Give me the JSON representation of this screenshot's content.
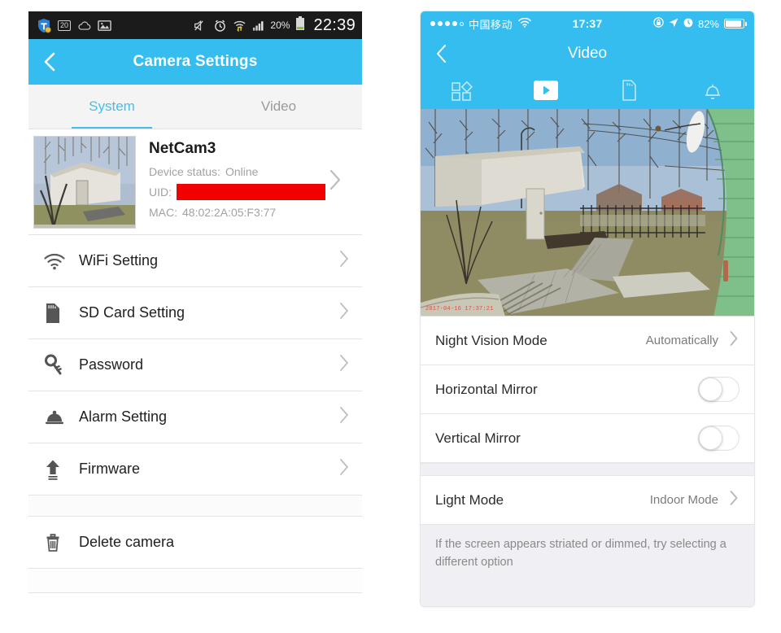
{
  "left_phone": {
    "status_bar": {
      "icons": [
        "shield-icon",
        "notification-count-icon",
        "cloud-icon",
        "image-icon",
        "mute-icon",
        "alarm-clock-icon",
        "wifi-transfer-icon",
        "signal-bars-icon"
      ],
      "notification_count": "20",
      "battery_percent": "20%",
      "clock": "22:39"
    },
    "header": {
      "title": "Camera Settings",
      "back_icon": "chevron-left-icon"
    },
    "tabs": [
      {
        "label": "System",
        "active": true
      },
      {
        "label": "Video",
        "active": false
      }
    ],
    "device_card": {
      "name": "NetCam3",
      "status_label": "Device status:",
      "status_value": "Online",
      "uid_label": "UID:",
      "uid_value": "",
      "mac_label": "MAC:",
      "mac_value": "48:02:2A:05:F3:77",
      "thumbnail_alt": "camera snapshot of white shed and bare trees",
      "chevron": "chevron-right-icon"
    },
    "menu_items": [
      {
        "label": "WiFi Setting",
        "icon": "wifi-icon",
        "chevron": true
      },
      {
        "label": "SD Card Setting",
        "icon": "sd-card-icon",
        "chevron": true
      },
      {
        "label": "Password",
        "icon": "key-icon",
        "chevron": true
      },
      {
        "label": "Alarm Setting",
        "icon": "bell-icon",
        "chevron": true
      },
      {
        "label": "Firmware",
        "icon": "upload-arrow-icon",
        "chevron": true
      }
    ],
    "danger_items": [
      {
        "label": "Delete camera",
        "icon": "trash-icon",
        "chevron": false
      }
    ]
  },
  "right_phone": {
    "status_bar": {
      "signal_dots_filled": 4,
      "signal_dots_total": 5,
      "carrier": "中国移动",
      "wifi_icon": "wifi-icon",
      "time": "17:37",
      "icons": [
        "rotation-lock-icon",
        "location-arrow-icon",
        "alarm-icon"
      ],
      "battery_percent": "82%"
    },
    "header": {
      "title": "Video",
      "back_icon": "chevron-left-icon"
    },
    "toolbar": [
      {
        "name": "grid-icon",
        "active": false
      },
      {
        "name": "play-icon",
        "active": true
      },
      {
        "name": "sd-card-icon",
        "active": false
      },
      {
        "name": "bell-icon",
        "active": false
      }
    ],
    "video": {
      "timestamp": "2017-04-16 17:37:21"
    },
    "settings": [
      {
        "label": "Night Vision Mode",
        "value": "Automatically",
        "control": "chevron"
      },
      {
        "label": "Horizontal Mirror",
        "value": "",
        "control": "toggle",
        "on": false
      },
      {
        "label": "Vertical Mirror",
        "value": "",
        "control": "toggle",
        "on": false
      }
    ],
    "settings_group2": [
      {
        "label": "Light Mode",
        "value": "Indoor Mode",
        "control": "chevron"
      }
    ],
    "note": "If the screen appears striated or dimmed, try selecting a different option"
  },
  "colors": {
    "brand_blue": "#35bdf0",
    "tab_active": "#46bfe8",
    "redaction_red": "#f20000",
    "ios_group_bg": "#efeff4",
    "android_status_bg": "#1b1b1b"
  }
}
